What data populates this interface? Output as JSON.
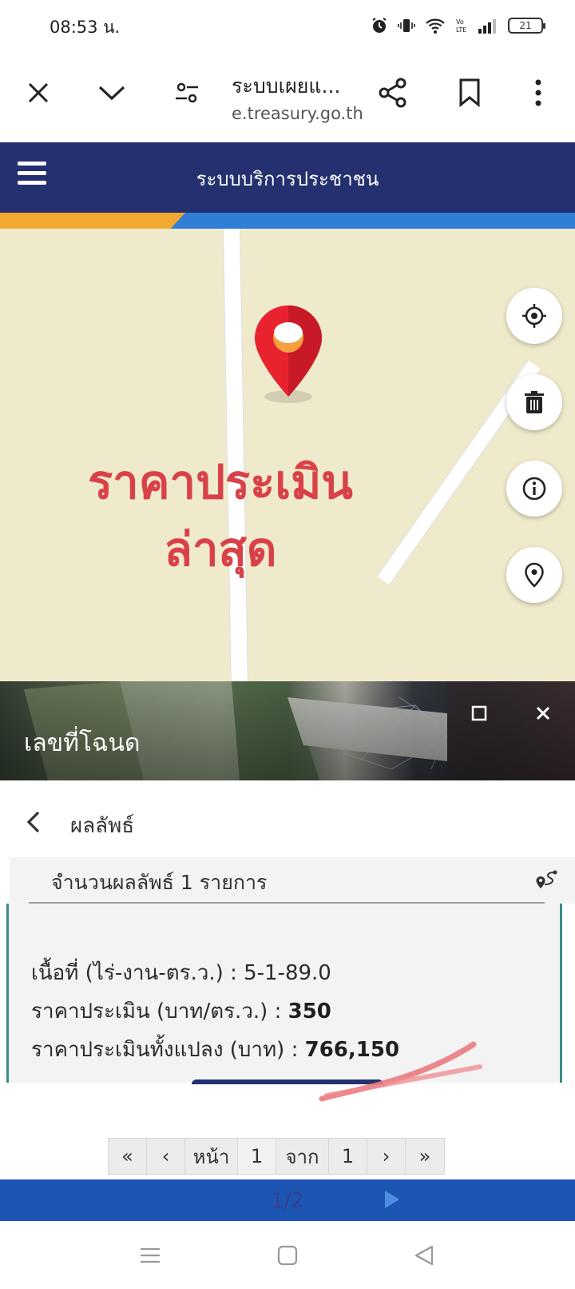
{
  "status_bar": {
    "time": "08:53 น.",
    "battery": "21"
  },
  "browser": {
    "title": "ระบบเผยแ...",
    "url": "e.treasury.go.th"
  },
  "app": {
    "title": "ระบบบริการประชาชน"
  },
  "map": {
    "watermark_line1": "ราคาประเมิน",
    "watermark_line2": "ล่าสุด"
  },
  "panel": {
    "title": "เลขที่โฉนด"
  },
  "results": {
    "header": "ผลลัพธ์",
    "count_text": "จำนวนผลลัพธ์ 1 รายการ",
    "area_label": "เนื้อที่ (ไร่-งาน-ตร.ว.) :",
    "area_value": "5-1-89.0",
    "price_label": "ราคาประเมิน (บาท/ตร.ว.) :",
    "price_value": "350",
    "total_label": "ราคาประเมินทั้งแปลง (บาท) :",
    "total_value": "766,150"
  },
  "pagination": {
    "first": "«",
    "prev": "‹",
    "page_label": "หน้า",
    "current_page": "1",
    "of_label": "จาก",
    "total_pages": "1",
    "next": "›",
    "last": "»"
  },
  "bottom_bar": {
    "page_indicator": "1/2"
  },
  "colors": {
    "header_bg": "#24306f",
    "accent_orange": "#f3a930",
    "accent_blue": "#2f7fd6",
    "map_bg": "#efeacb",
    "pin_red": "#e8232f",
    "watermark_red": "#d94148"
  }
}
